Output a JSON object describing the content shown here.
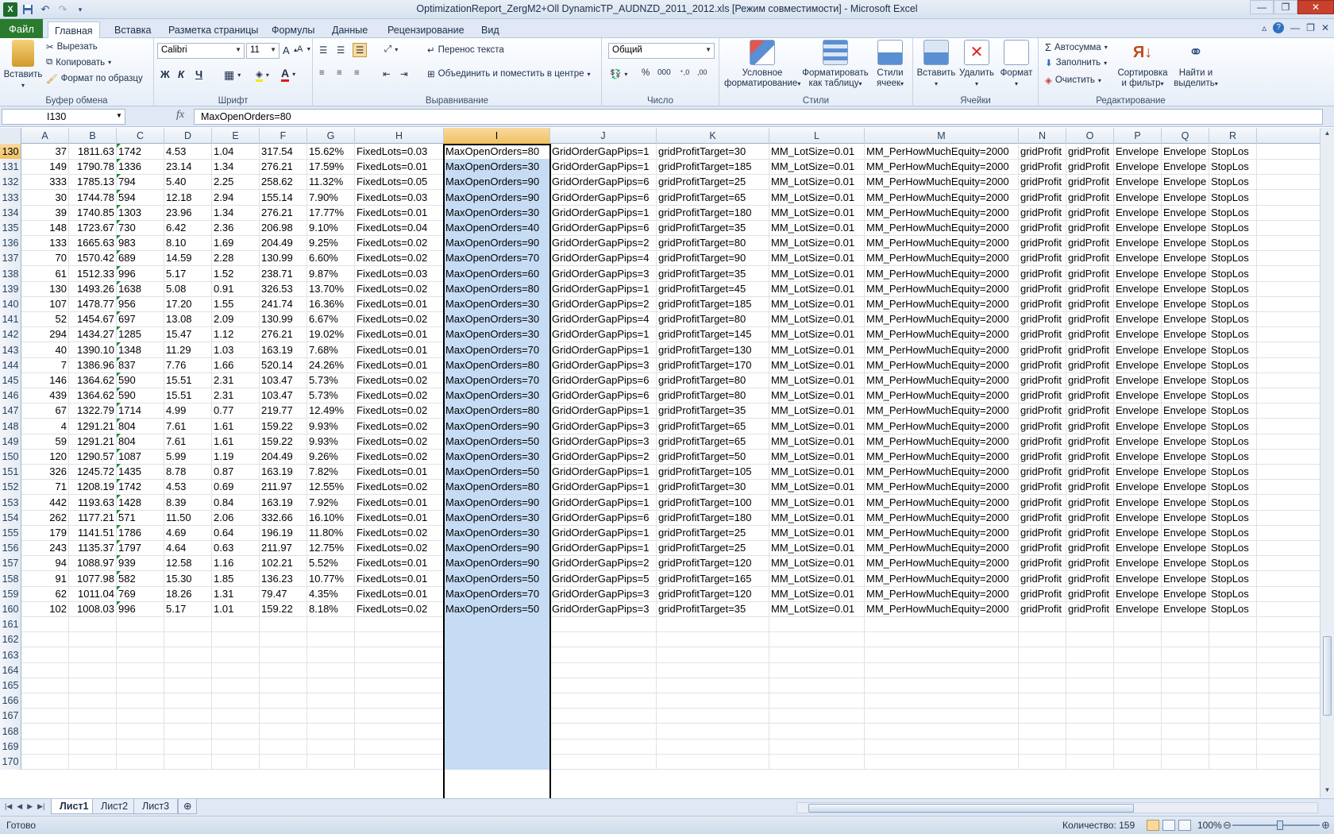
{
  "window": {
    "title": "OptimizationReport_ZergM2+Oll DynamicTP_AUDNZD_2011_2012.xls  [Режим совместимости]  -  Microsoft Excel"
  },
  "qat": {
    "save_icon": "save-icon",
    "undo_icon": "undo-icon",
    "redo_icon": "redo-icon"
  },
  "tabs": {
    "file": "Файл",
    "items": [
      "Главная",
      "Вставка",
      "Разметка страницы",
      "Формулы",
      "Данные",
      "Рецензирование",
      "Вид"
    ]
  },
  "ribbon": {
    "clipboard": {
      "title": "Буфер обмена",
      "paste": "Вставить",
      "cut": "Вырезать",
      "copy": "Копировать",
      "format_painter": "Формат по образцу"
    },
    "font": {
      "title": "Шрифт",
      "family": "Calibri",
      "size": "11",
      "bold": "Ж",
      "italic": "К",
      "underline": "Ч"
    },
    "alignment": {
      "title": "Выравнивание",
      "wrap": "Перенос текста",
      "merge": "Объединить и поместить в центре"
    },
    "number": {
      "title": "Число",
      "format": "Общий",
      "percent": "%",
      "thousands": "000"
    },
    "styles": {
      "title": "Стили",
      "conditional": [
        "Условное",
        "форматирование"
      ],
      "as_table": [
        "Форматировать",
        "как таблицу"
      ],
      "cell_styles": [
        "Стили",
        "ячеек"
      ]
    },
    "cells": {
      "title": "Ячейки",
      "insert": "Вставить",
      "delete": "Удалить",
      "format": "Формат"
    },
    "editing": {
      "title": "Редактирование",
      "autosum": "Автосумма",
      "fill": "Заполнить",
      "clear": "Очистить",
      "sort": [
        "Сортировка",
        "и фильтр"
      ],
      "find": [
        "Найти и",
        "выделить"
      ]
    }
  },
  "formula_bar": {
    "name_box": "I130",
    "fx": "fx",
    "formula": "MaxOpenOrders=80"
  },
  "columns": [
    "A",
    "B",
    "C",
    "D",
    "E",
    "F",
    "G",
    "H",
    "I",
    "J",
    "K",
    "L",
    "M",
    "N",
    "O",
    "P",
    "Q",
    "R"
  ],
  "selected_column": "I",
  "rows": [
    {
      "n": "130",
      "cells": [
        "37",
        "1811.63",
        "1742",
        "4.53",
        "1.04",
        "317.54",
        "15.62%",
        "FixedLots=0.03",
        "MaxOpenOrders=80",
        "GridOrderGapPips=1",
        "gridProfitTarget=30",
        "MM_LotSize=0.01",
        "MM_PerHowMuchEquity=2000",
        "gridProfit",
        "gridProfit",
        "Envelope",
        "Envelope",
        "StopLos"
      ]
    },
    {
      "n": "131",
      "cells": [
        "149",
        "1790.78",
        "1336",
        "23.14",
        "1.34",
        "276.21",
        "17.59%",
        "FixedLots=0.01",
        "MaxOpenOrders=30",
        "GridOrderGapPips=1",
        "gridProfitTarget=185",
        "MM_LotSize=0.01",
        "MM_PerHowMuchEquity=2000",
        "gridProfit",
        "gridProfit",
        "Envelope",
        "Envelope",
        "StopLos"
      ]
    },
    {
      "n": "132",
      "cells": [
        "333",
        "1785.13",
        "794",
        "5.40",
        "2.25",
        "258.62",
        "11.32%",
        "FixedLots=0.05",
        "MaxOpenOrders=90",
        "GridOrderGapPips=6",
        "gridProfitTarget=25",
        "MM_LotSize=0.01",
        "MM_PerHowMuchEquity=2000",
        "gridProfit",
        "gridProfit",
        "Envelope",
        "Envelope",
        "StopLos"
      ]
    },
    {
      "n": "133",
      "cells": [
        "30",
        "1744.78",
        "594",
        "12.18",
        "2.94",
        "155.14",
        "7.90%",
        "FixedLots=0.03",
        "MaxOpenOrders=90",
        "GridOrderGapPips=6",
        "gridProfitTarget=65",
        "MM_LotSize=0.01",
        "MM_PerHowMuchEquity=2000",
        "gridProfit",
        "gridProfit",
        "Envelope",
        "Envelope",
        "StopLos"
      ]
    },
    {
      "n": "134",
      "cells": [
        "39",
        "1740.85",
        "1303",
        "23.96",
        "1.34",
        "276.21",
        "17.77%",
        "FixedLots=0.01",
        "MaxOpenOrders=30",
        "GridOrderGapPips=1",
        "gridProfitTarget=180",
        "MM_LotSize=0.01",
        "MM_PerHowMuchEquity=2000",
        "gridProfit",
        "gridProfit",
        "Envelope",
        "Envelope",
        "StopLos"
      ]
    },
    {
      "n": "135",
      "cells": [
        "148",
        "1723.67",
        "730",
        "6.42",
        "2.36",
        "206.98",
        "9.10%",
        "FixedLots=0.04",
        "MaxOpenOrders=40",
        "GridOrderGapPips=6",
        "gridProfitTarget=35",
        "MM_LotSize=0.01",
        "MM_PerHowMuchEquity=2000",
        "gridProfit",
        "gridProfit",
        "Envelope",
        "Envelope",
        "StopLos"
      ]
    },
    {
      "n": "136",
      "cells": [
        "133",
        "1665.63",
        "983",
        "8.10",
        "1.69",
        "204.49",
        "9.25%",
        "FixedLots=0.02",
        "MaxOpenOrders=90",
        "GridOrderGapPips=2",
        "gridProfitTarget=80",
        "MM_LotSize=0.01",
        "MM_PerHowMuchEquity=2000",
        "gridProfit",
        "gridProfit",
        "Envelope",
        "Envelope",
        "StopLos"
      ]
    },
    {
      "n": "137",
      "cells": [
        "70",
        "1570.42",
        "689",
        "14.59",
        "2.28",
        "130.99",
        "6.60%",
        "FixedLots=0.02",
        "MaxOpenOrders=70",
        "GridOrderGapPips=4",
        "gridProfitTarget=90",
        "MM_LotSize=0.01",
        "MM_PerHowMuchEquity=2000",
        "gridProfit",
        "gridProfit",
        "Envelope",
        "Envelope",
        "StopLos"
      ]
    },
    {
      "n": "138",
      "cells": [
        "61",
        "1512.33",
        "996",
        "5.17",
        "1.52",
        "238.71",
        "9.87%",
        "FixedLots=0.03",
        "MaxOpenOrders=60",
        "GridOrderGapPips=3",
        "gridProfitTarget=35",
        "MM_LotSize=0.01",
        "MM_PerHowMuchEquity=2000",
        "gridProfit",
        "gridProfit",
        "Envelope",
        "Envelope",
        "StopLos"
      ]
    },
    {
      "n": "139",
      "cells": [
        "130",
        "1493.26",
        "1638",
        "5.08",
        "0.91",
        "326.53",
        "13.70%",
        "FixedLots=0.02",
        "MaxOpenOrders=80",
        "GridOrderGapPips=1",
        "gridProfitTarget=45",
        "MM_LotSize=0.01",
        "MM_PerHowMuchEquity=2000",
        "gridProfit",
        "gridProfit",
        "Envelope",
        "Envelope",
        "StopLos"
      ]
    },
    {
      "n": "140",
      "cells": [
        "107",
        "1478.77",
        "956",
        "17.20",
        "1.55",
        "241.74",
        "16.36%",
        "FixedLots=0.01",
        "MaxOpenOrders=30",
        "GridOrderGapPips=2",
        "gridProfitTarget=185",
        "MM_LotSize=0.01",
        "MM_PerHowMuchEquity=2000",
        "gridProfit",
        "gridProfit",
        "Envelope",
        "Envelope",
        "StopLos"
      ]
    },
    {
      "n": "141",
      "cells": [
        "52",
        "1454.67",
        "697",
        "13.08",
        "2.09",
        "130.99",
        "6.67%",
        "FixedLots=0.02",
        "MaxOpenOrders=30",
        "GridOrderGapPips=4",
        "gridProfitTarget=80",
        "MM_LotSize=0.01",
        "MM_PerHowMuchEquity=2000",
        "gridProfit",
        "gridProfit",
        "Envelope",
        "Envelope",
        "StopLos"
      ]
    },
    {
      "n": "142",
      "cells": [
        "294",
        "1434.27",
        "1285",
        "15.47",
        "1.12",
        "276.21",
        "19.02%",
        "FixedLots=0.01",
        "MaxOpenOrders=30",
        "GridOrderGapPips=1",
        "gridProfitTarget=145",
        "MM_LotSize=0.01",
        "MM_PerHowMuchEquity=2000",
        "gridProfit",
        "gridProfit",
        "Envelope",
        "Envelope",
        "StopLos"
      ]
    },
    {
      "n": "143",
      "cells": [
        "40",
        "1390.10",
        "1348",
        "11.29",
        "1.03",
        "163.19",
        "7.68%",
        "FixedLots=0.01",
        "MaxOpenOrders=70",
        "GridOrderGapPips=1",
        "gridProfitTarget=130",
        "MM_LotSize=0.01",
        "MM_PerHowMuchEquity=2000",
        "gridProfit",
        "gridProfit",
        "Envelope",
        "Envelope",
        "StopLos"
      ]
    },
    {
      "n": "144",
      "cells": [
        "7",
        "1386.96",
        "837",
        "7.76",
        "1.66",
        "520.14",
        "24.26%",
        "FixedLots=0.01",
        "MaxOpenOrders=80",
        "GridOrderGapPips=3",
        "gridProfitTarget=170",
        "MM_LotSize=0.01",
        "MM_PerHowMuchEquity=2000",
        "gridProfit",
        "gridProfit",
        "Envelope",
        "Envelope",
        "StopLos"
      ]
    },
    {
      "n": "145",
      "cells": [
        "146",
        "1364.62",
        "590",
        "15.51",
        "2.31",
        "103.47",
        "5.73%",
        "FixedLots=0.02",
        "MaxOpenOrders=70",
        "GridOrderGapPips=6",
        "gridProfitTarget=80",
        "MM_LotSize=0.01",
        "MM_PerHowMuchEquity=2000",
        "gridProfit",
        "gridProfit",
        "Envelope",
        "Envelope",
        "StopLos"
      ]
    },
    {
      "n": "146",
      "cells": [
        "439",
        "1364.62",
        "590",
        "15.51",
        "2.31",
        "103.47",
        "5.73%",
        "FixedLots=0.02",
        "MaxOpenOrders=30",
        "GridOrderGapPips=6",
        "gridProfitTarget=80",
        "MM_LotSize=0.01",
        "MM_PerHowMuchEquity=2000",
        "gridProfit",
        "gridProfit",
        "Envelope",
        "Envelope",
        "StopLos"
      ]
    },
    {
      "n": "147",
      "cells": [
        "67",
        "1322.79",
        "1714",
        "4.99",
        "0.77",
        "219.77",
        "12.49%",
        "FixedLots=0.02",
        "MaxOpenOrders=80",
        "GridOrderGapPips=1",
        "gridProfitTarget=35",
        "MM_LotSize=0.01",
        "MM_PerHowMuchEquity=2000",
        "gridProfit",
        "gridProfit",
        "Envelope",
        "Envelope",
        "StopLos"
      ]
    },
    {
      "n": "148",
      "cells": [
        "4",
        "1291.21",
        "804",
        "7.61",
        "1.61",
        "159.22",
        "9.93%",
        "FixedLots=0.02",
        "MaxOpenOrders=90",
        "GridOrderGapPips=3",
        "gridProfitTarget=65",
        "MM_LotSize=0.01",
        "MM_PerHowMuchEquity=2000",
        "gridProfit",
        "gridProfit",
        "Envelope",
        "Envelope",
        "StopLos"
      ]
    },
    {
      "n": "149",
      "cells": [
        "59",
        "1291.21",
        "804",
        "7.61",
        "1.61",
        "159.22",
        "9.93%",
        "FixedLots=0.02",
        "MaxOpenOrders=50",
        "GridOrderGapPips=3",
        "gridProfitTarget=65",
        "MM_LotSize=0.01",
        "MM_PerHowMuchEquity=2000",
        "gridProfit",
        "gridProfit",
        "Envelope",
        "Envelope",
        "StopLos"
      ]
    },
    {
      "n": "150",
      "cells": [
        "120",
        "1290.57",
        "1087",
        "5.99",
        "1.19",
        "204.49",
        "9.26%",
        "FixedLots=0.02",
        "MaxOpenOrders=30",
        "GridOrderGapPips=2",
        "gridProfitTarget=50",
        "MM_LotSize=0.01",
        "MM_PerHowMuchEquity=2000",
        "gridProfit",
        "gridProfit",
        "Envelope",
        "Envelope",
        "StopLos"
      ]
    },
    {
      "n": "151",
      "cells": [
        "326",
        "1245.72",
        "1435",
        "8.78",
        "0.87",
        "163.19",
        "7.82%",
        "FixedLots=0.01",
        "MaxOpenOrders=50",
        "GridOrderGapPips=1",
        "gridProfitTarget=105",
        "MM_LotSize=0.01",
        "MM_PerHowMuchEquity=2000",
        "gridProfit",
        "gridProfit",
        "Envelope",
        "Envelope",
        "StopLos"
      ]
    },
    {
      "n": "152",
      "cells": [
        "71",
        "1208.19",
        "1742",
        "4.53",
        "0.69",
        "211.97",
        "12.55%",
        "FixedLots=0.02",
        "MaxOpenOrders=80",
        "GridOrderGapPips=1",
        "gridProfitTarget=30",
        "MM_LotSize=0.01",
        "MM_PerHowMuchEquity=2000",
        "gridProfit",
        "gridProfit",
        "Envelope",
        "Envelope",
        "StopLos"
      ]
    },
    {
      "n": "153",
      "cells": [
        "442",
        "1193.63",
        "1428",
        "8.39",
        "0.84",
        "163.19",
        "7.92%",
        "FixedLots=0.01",
        "MaxOpenOrders=90",
        "GridOrderGapPips=1",
        "gridProfitTarget=100",
        "MM_LotSize=0.01",
        "MM_PerHowMuchEquity=2000",
        "gridProfit",
        "gridProfit",
        "Envelope",
        "Envelope",
        "StopLos"
      ]
    },
    {
      "n": "154",
      "cells": [
        "262",
        "1177.21",
        "571",
        "11.50",
        "2.06",
        "332.66",
        "16.10%",
        "FixedLots=0.01",
        "MaxOpenOrders=30",
        "GridOrderGapPips=6",
        "gridProfitTarget=180",
        "MM_LotSize=0.01",
        "MM_PerHowMuchEquity=2000",
        "gridProfit",
        "gridProfit",
        "Envelope",
        "Envelope",
        "StopLos"
      ]
    },
    {
      "n": "155",
      "cells": [
        "179",
        "1141.51",
        "1786",
        "4.69",
        "0.64",
        "196.19",
        "11.80%",
        "FixedLots=0.02",
        "MaxOpenOrders=30",
        "GridOrderGapPips=1",
        "gridProfitTarget=25",
        "MM_LotSize=0.01",
        "MM_PerHowMuchEquity=2000",
        "gridProfit",
        "gridProfit",
        "Envelope",
        "Envelope",
        "StopLos"
      ]
    },
    {
      "n": "156",
      "cells": [
        "243",
        "1135.37",
        "1797",
        "4.64",
        "0.63",
        "211.97",
        "12.75%",
        "FixedLots=0.02",
        "MaxOpenOrders=90",
        "GridOrderGapPips=1",
        "gridProfitTarget=25",
        "MM_LotSize=0.01",
        "MM_PerHowMuchEquity=2000",
        "gridProfit",
        "gridProfit",
        "Envelope",
        "Envelope",
        "StopLos"
      ]
    },
    {
      "n": "157",
      "cells": [
        "94",
        "1088.97",
        "939",
        "12.58",
        "1.16",
        "102.21",
        "5.52%",
        "FixedLots=0.01",
        "MaxOpenOrders=90",
        "GridOrderGapPips=2",
        "gridProfitTarget=120",
        "MM_LotSize=0.01",
        "MM_PerHowMuchEquity=2000",
        "gridProfit",
        "gridProfit",
        "Envelope",
        "Envelope",
        "StopLos"
      ]
    },
    {
      "n": "158",
      "cells": [
        "91",
        "1077.98",
        "582",
        "15.30",
        "1.85",
        "136.23",
        "10.77%",
        "FixedLots=0.01",
        "MaxOpenOrders=50",
        "GridOrderGapPips=5",
        "gridProfitTarget=165",
        "MM_LotSize=0.01",
        "MM_PerHowMuchEquity=2000",
        "gridProfit",
        "gridProfit",
        "Envelope",
        "Envelope",
        "StopLos"
      ]
    },
    {
      "n": "159",
      "cells": [
        "62",
        "1011.04",
        "769",
        "18.26",
        "1.31",
        "79.47",
        "4.35%",
        "FixedLots=0.01",
        "MaxOpenOrders=70",
        "GridOrderGapPips=3",
        "gridProfitTarget=120",
        "MM_LotSize=0.01",
        "MM_PerHowMuchEquity=2000",
        "gridProfit",
        "gridProfit",
        "Envelope",
        "Envelope",
        "StopLos"
      ]
    },
    {
      "n": "160",
      "cells": [
        "102",
        "1008.03",
        "996",
        "5.17",
        "1.01",
        "159.22",
        "8.18%",
        "FixedLots=0.02",
        "MaxOpenOrders=50",
        "GridOrderGapPips=3",
        "gridProfitTarget=35",
        "MM_LotSize=0.01",
        "MM_PerHowMuchEquity=2000",
        "gridProfit",
        "gridProfit",
        "Envelope",
        "Envelope",
        "StopLos"
      ]
    },
    {
      "n": "161",
      "cells": []
    },
    {
      "n": "162",
      "cells": []
    },
    {
      "n": "163",
      "cells": []
    },
    {
      "n": "164",
      "cells": []
    },
    {
      "n": "165",
      "cells": []
    },
    {
      "n": "166",
      "cells": []
    },
    {
      "n": "167",
      "cells": []
    },
    {
      "n": "168",
      "cells": []
    },
    {
      "n": "169",
      "cells": []
    },
    {
      "n": "170",
      "cells": []
    }
  ],
  "sheets": [
    "Лист1",
    "Лист2",
    "Лист3"
  ],
  "active_sheet": "Лист1",
  "status": {
    "ready": "Готово",
    "count": "Количество: 159",
    "zoom": "100%"
  },
  "colors": {
    "file_tab": "#2a7b2e",
    "selection": "#c5dcf4",
    "header_highlight": "#f1c15f"
  }
}
